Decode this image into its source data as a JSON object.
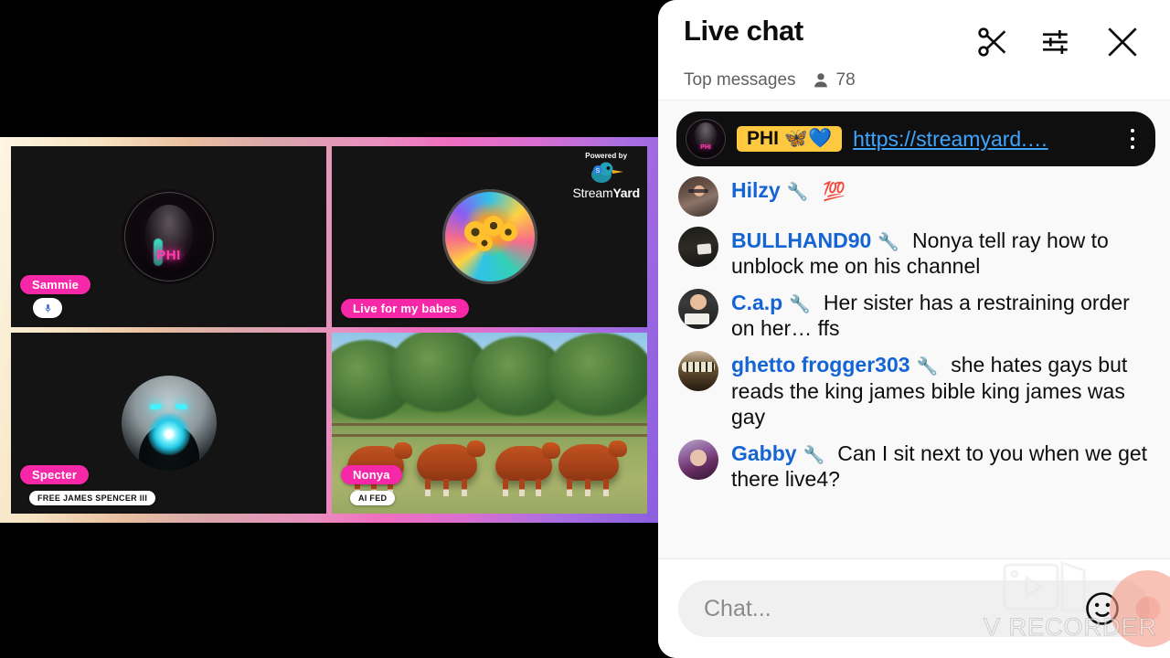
{
  "stage": {
    "powered_by": {
      "prefix": "Powered by",
      "brand_light": "Stream",
      "brand_bold": "Yard",
      "icon": "duck-icon"
    },
    "tiles": [
      {
        "name": "Sammie",
        "sub": "",
        "has_mic": true,
        "art": "phi-logo"
      },
      {
        "name": "Live for my babes",
        "sub": "",
        "has_mic": false,
        "art": "sunflower-logo"
      },
      {
        "name": "Specter",
        "sub": "FREE JAMES SPENCER III",
        "has_mic": false,
        "art": "specter-logo"
      },
      {
        "name": "Nonya",
        "sub": "AI FED",
        "has_mic": false,
        "art": "cattle-photo"
      }
    ]
  },
  "chat": {
    "title": "Live chat",
    "subtitle": "Top messages",
    "viewer_count": "78",
    "icons": {
      "clip": "scissors-icon",
      "settings": "chat-settings-icon",
      "close": "close-icon",
      "viewers": "person-icon",
      "overflow": "more-vert-icon",
      "emoji": "emoji-smiley-icon"
    },
    "colors": {
      "author": "#1464d4",
      "link": "#3ea6ff",
      "pinned_bg": "#0f0f0f",
      "author_badge_bg": "#ffc93f",
      "name_tag_bg": "#f728a8"
    },
    "pinned": {
      "author": "PHI 🦋💙",
      "link": "https://streamyard.…",
      "avatar": "phi-avatar"
    },
    "messages": [
      {
        "author": "Hilzy",
        "badge": "🔧",
        "emoji": "💯",
        "text": "",
        "avatar": "av-hilzy"
      },
      {
        "author": "BULLHAND90",
        "badge": "🔧",
        "emoji": "",
        "text": "Nonya tell ray how to unblock me on his channel",
        "avatar": "av-bull"
      },
      {
        "author": "C.a.p",
        "badge": "🔧",
        "emoji": "",
        "text": "Her sister has a restraining order on her… ffs",
        "avatar": "av-cap"
      },
      {
        "author": "ghetto frogger303",
        "badge": "🔧",
        "emoji": "",
        "text": "she hates gays but reads the king james bible king james was gay",
        "avatar": "av-frog"
      },
      {
        "author": "Gabby",
        "badge": "🔧",
        "emoji": "",
        "text": "Can I sit next to you when we get there live4?",
        "avatar": "av-gabby"
      }
    ],
    "input": {
      "placeholder": "Chat...",
      "value": ""
    }
  },
  "watermark": {
    "text": "V RECORDER",
    "icon": "video-recorder-icon"
  }
}
